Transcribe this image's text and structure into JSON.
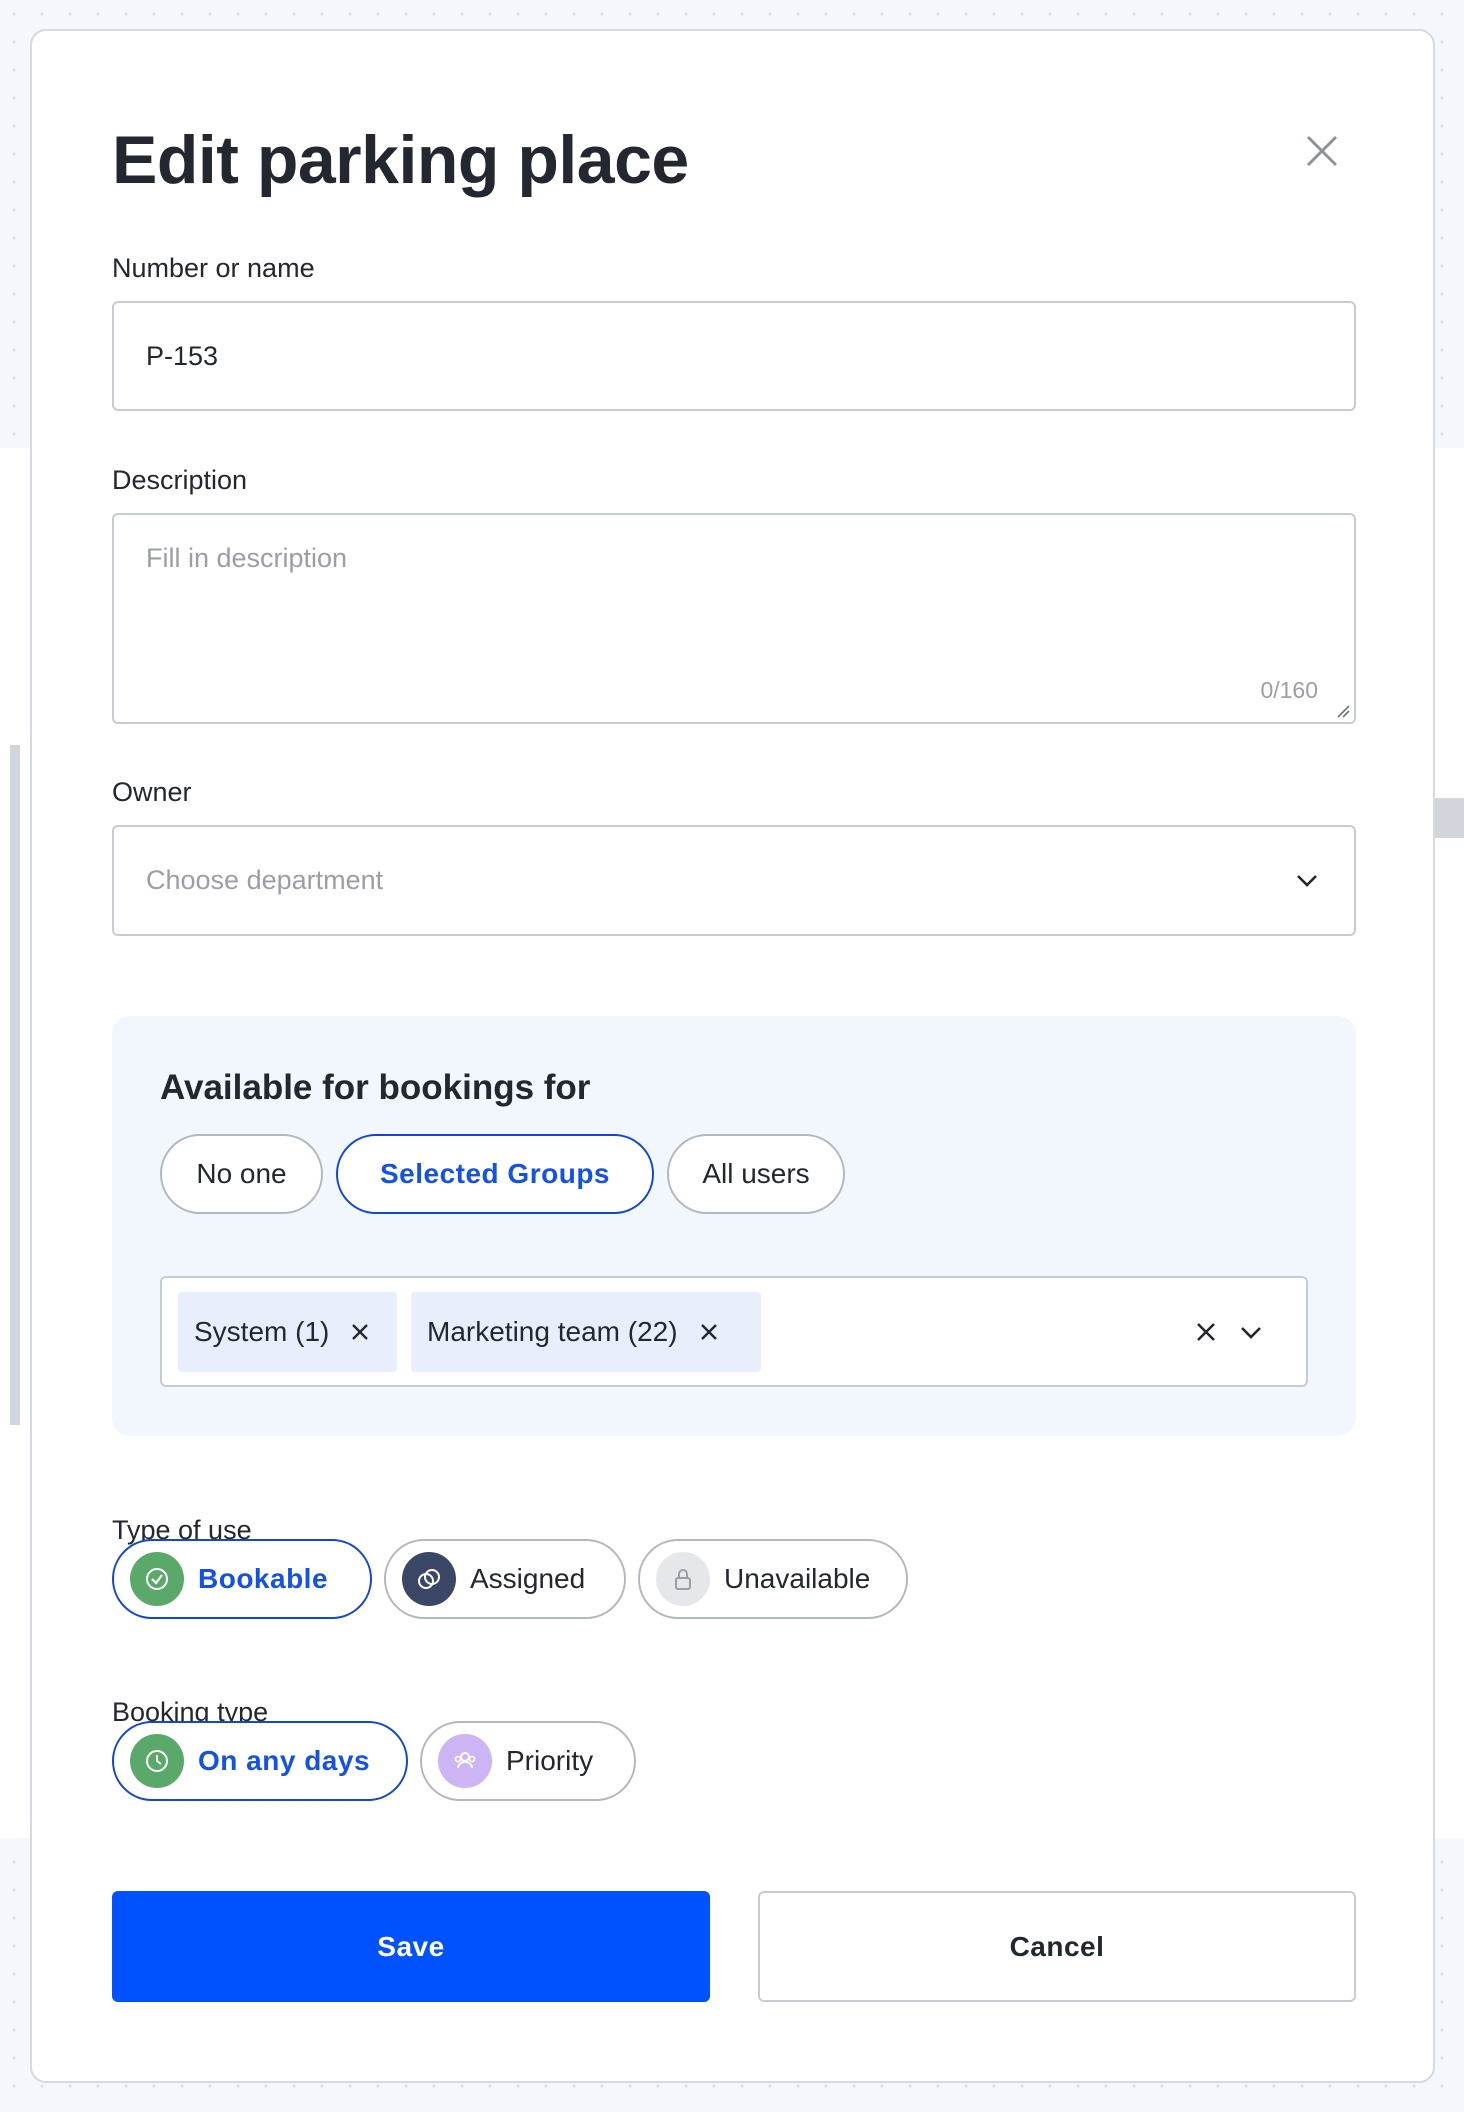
{
  "modal": {
    "title": "Edit parking place"
  },
  "fields": {
    "name": {
      "label": "Number or name",
      "value": "P-153"
    },
    "description": {
      "label": "Description",
      "placeholder": "Fill in description",
      "counter": "0/160"
    },
    "owner": {
      "label": "Owner",
      "placeholder": "Choose department"
    }
  },
  "availability": {
    "title": "Available for bookings for",
    "options": [
      "No one",
      "Selected Groups",
      "All users"
    ],
    "selected": "Selected Groups",
    "groups": [
      "System (1)",
      "Marketing team (22)"
    ]
  },
  "type_of_use": {
    "label": "Type of use",
    "options": [
      {
        "label": "Bookable",
        "icon": "check-circle-icon",
        "color": "#5aa86a",
        "active": true
      },
      {
        "label": "Assigned",
        "icon": "link-icon",
        "color": "#3b4766",
        "active": false
      },
      {
        "label": "Unavailable",
        "icon": "lock-icon",
        "color": "#e6e7ea",
        "active": false
      }
    ]
  },
  "booking_type": {
    "label": "Booking type",
    "options": [
      {
        "label": "On any days",
        "icon": "clock-icon",
        "color": "#5aa86a",
        "active": true
      },
      {
        "label": "Priority",
        "icon": "users-icon",
        "color": "#cdb5f5",
        "active": false
      }
    ]
  },
  "actions": {
    "save_label": "Save",
    "cancel_label": "Cancel"
  },
  "colors": {
    "primary": "#0051ff",
    "active_border": "#1146d6",
    "panel_bg": "#f2f6fd",
    "chip_bg": "#e9eefc"
  }
}
